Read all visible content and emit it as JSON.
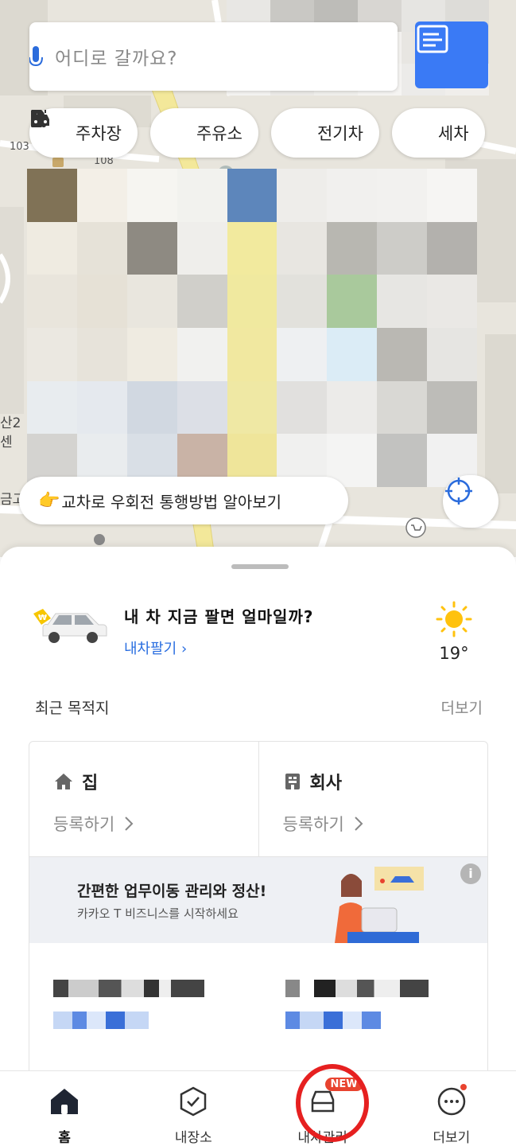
{
  "search": {
    "placeholder": "어디로 갈까요?"
  },
  "chips": [
    {
      "label": "주차장",
      "icon": "parking-icon"
    },
    {
      "label": "주유소",
      "icon": "gas-station-icon"
    },
    {
      "label": "전기차",
      "icon": "ev-charger-icon"
    },
    {
      "label": "세차",
      "icon": "car-wash-icon"
    }
  ],
  "map": {
    "labels": {
      "n103": "103",
      "n108": "108"
    },
    "side_text": {
      "s1": "산2",
      "s2": "센",
      "s3": "금고"
    }
  },
  "notice": {
    "emoji": "👉",
    "text": "교차로 우회전 통행방법 알아보기"
  },
  "promo": {
    "title": "내 차 지금 팔면 얼마일까?",
    "link": "내차팔기 ›",
    "badge": "₩"
  },
  "weather": {
    "temp": "19°",
    "icon": "sun-icon"
  },
  "recent": {
    "title": "최근 목적지",
    "more": "더보기"
  },
  "places": [
    {
      "name": "집",
      "action": "등록하기",
      "icon": "home-icon"
    },
    {
      "name": "회사",
      "action": "등록하기",
      "icon": "building-icon"
    }
  ],
  "biz": {
    "title": "간편한 업무이동 관리와 정산!",
    "subtitle": "카카오 T 비즈니스를 시작하세요",
    "info": "i"
  },
  "nav": {
    "items": [
      {
        "label": "홈",
        "icon": "home-icon",
        "active": true
      },
      {
        "label": "내장소",
        "icon": "check-shield-icon",
        "active": false
      },
      {
        "label": "내차관리",
        "icon": "car-icon",
        "active": false,
        "badge": "NEW"
      },
      {
        "label": "더보기",
        "icon": "more-icon",
        "active": false
      }
    ]
  },
  "colors": {
    "accent": "#3a7af5",
    "link": "#2a6ee0",
    "badge": "#e8432f",
    "highlight_ring": "#e62020"
  }
}
